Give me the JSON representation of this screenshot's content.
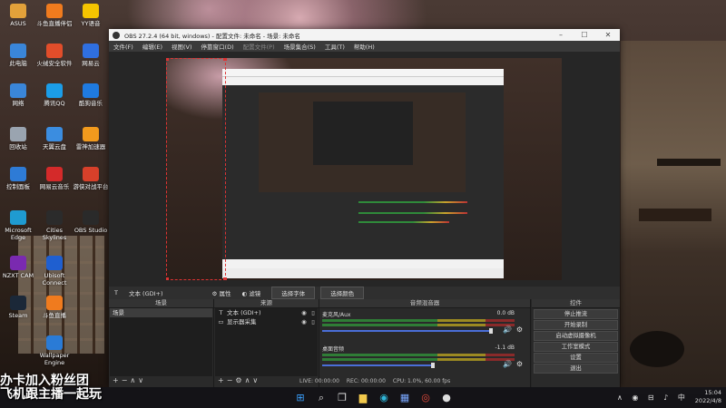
{
  "desktop_icons": [
    {
      "label": "ASUS",
      "color": "#e2a13a"
    },
    {
      "label": "斗鱼直播伴侣",
      "color": "#f07b1e"
    },
    {
      "label": "YY语音",
      "color": "#f5c400"
    },
    {
      "label": "此电脑",
      "color": "#3a86d9"
    },
    {
      "label": "火绒安全软件",
      "color": "#e14d2a"
    },
    {
      "label": "网易云",
      "color": "#2f6fe0"
    },
    {
      "label": "网络",
      "color": "#3a86d9"
    },
    {
      "label": "腾讯QQ",
      "color": "#1b9de8"
    },
    {
      "label": "酷狗音乐",
      "color": "#1f7ae0"
    },
    {
      "label": "回收站",
      "color": "#9aa4b0"
    },
    {
      "label": "天翼云盘",
      "color": "#3b8de0"
    },
    {
      "label": "雷神加速器",
      "color": "#f29a1d"
    },
    {
      "label": "控制面板",
      "color": "#2e7bd6"
    },
    {
      "label": "网易云音乐",
      "color": "#d42a2a"
    },
    {
      "label": "游侠对战平台",
      "color": "#d7402a"
    },
    {
      "label": "Microsoft Edge",
      "color": "#1f9bd1"
    },
    {
      "label": "Cities Skylines",
      "color": "#2b2b2b"
    },
    {
      "label": "OBS Studio",
      "color": "#2a2a2a"
    },
    {
      "label": "NZXT CAM",
      "color": "#7a2ab0"
    },
    {
      "label": "Ubisoft Connect",
      "color": "#1f5fd0"
    },
    {
      "label": "Steam",
      "color": "#1b2838"
    },
    {
      "label": "斗鱼直播",
      "color": "#f07b1e"
    },
    {
      "label": "Wallpaper Engine",
      "color": "#2a7bd6"
    }
  ],
  "obs": {
    "title": "OBS 27.2.4 (64 bit, windows) - 配置文件: 未命名 - 场景: 未命名",
    "menu": [
      "文件(F)",
      "编辑(E)",
      "视图(V)",
      "停靠窗口(D)",
      "配置文件(P)",
      "场景集合(S)",
      "工具(T)",
      "帮助(H)"
    ],
    "source_bar": {
      "selected": "文本 (GDI+)",
      "properties": "属性",
      "filters": "滤镜",
      "select_font": "选择字体",
      "select_color": "选择颜色"
    },
    "scenes": {
      "header": "场景",
      "items": [
        "场景"
      ]
    },
    "sources": {
      "header": "来源",
      "items": [
        {
          "icon": "T",
          "name": "文本 (GDI+)"
        },
        {
          "icon": "▭",
          "name": "显示器采集"
        }
      ]
    },
    "mixer": {
      "header": "音频混音器",
      "channels": [
        {
          "name": "麦克风/Aux",
          "db": "0.0 dB",
          "level": 0.95
        },
        {
          "name": "桌面音频",
          "db": "-1.1 dB",
          "level": 0.62
        }
      ]
    },
    "controls": {
      "header": "控件",
      "buttons": [
        "停止推流",
        "开始录制",
        "启动虚拟摄像机",
        "工作室模式",
        "设置",
        "退出"
      ]
    },
    "status": {
      "live": "LIVE: 00:00:00",
      "rec": "REC: 00:00:00",
      "cpu": "CPU: 1.0%, 60.00 fps"
    }
  },
  "overlay_text": [
    "办卡加入粉丝团",
    "飞机跟主播一起玩"
  ],
  "taskbar": {
    "icons": [
      "windows-icon",
      "search-icon",
      "task-view-icon",
      "file-explorer-icon",
      "edge-icon",
      "store-icon",
      "chrome-icon",
      "obs-icon"
    ],
    "time": "15:04",
    "date": "2022/4/8"
  }
}
